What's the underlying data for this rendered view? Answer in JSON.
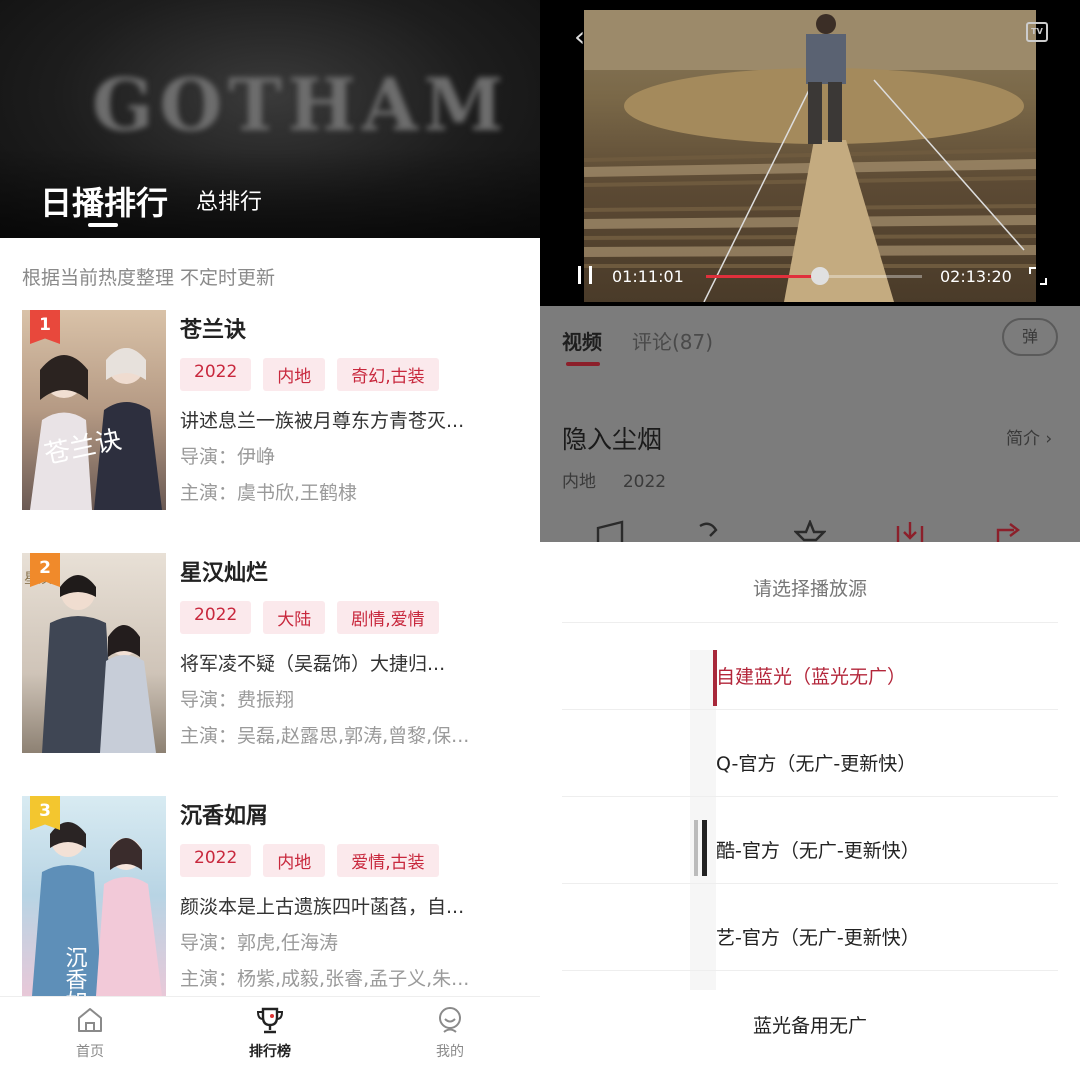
{
  "left": {
    "hero": {
      "background_text": "GOTHAM"
    },
    "tabs": {
      "daily": "日播排行",
      "total": "总排行"
    },
    "notice": "根据当前热度整理 不定时更新",
    "director_prefix": "导演：",
    "cast_prefix": "主演：",
    "items": [
      {
        "rank": "1",
        "rank_color": "#e8483c",
        "title": "苍兰诀",
        "year": "2022",
        "region": "内地",
        "genre": "奇幻,古装",
        "desc": "讲述息兰一族被月尊东方青苍灭...",
        "director": "伊峥",
        "cast": "虞书欣,王鹤棣"
      },
      {
        "rank": "2",
        "rank_color": "#f08a2b",
        "title": "星汉灿烂",
        "year": "2022",
        "region": "大陆",
        "genre": "剧情,爱情",
        "desc": "将军凌不疑（吴磊饰）大捷归...",
        "director": "费振翔",
        "cast": "吴磊,赵露思,郭涛,曾黎,保..."
      },
      {
        "rank": "3",
        "rank_color": "#f3c62f",
        "title": "沉香如屑",
        "year": "2022",
        "region": "内地",
        "genre": "爱情,古装",
        "desc": "颜淡本是上古遗族四叶菡萏，自...",
        "director": "郭虎,任海涛",
        "cast": "杨紫,成毅,张睿,孟子义,朱..."
      }
    ],
    "bottom_nav": {
      "home": "首页",
      "ranking": "排行榜",
      "mine": "我的"
    }
  },
  "right": {
    "player": {
      "current_time": "01:11:01",
      "total_time": "02:13:20",
      "progress": 0.53,
      "tv_label": "TV"
    },
    "tabs": {
      "video": "视频",
      "comments": "评论(87)"
    },
    "danmaku": "弹",
    "show": {
      "title": "隐入尘烟",
      "intro": "简介 ›",
      "region": "内地",
      "year": "2022"
    },
    "sheet": {
      "title": "请选择播放源",
      "sources": [
        "自建蓝光（蓝光无广）",
        "Q-官方（无广-更新快）",
        "酷-官方（无广-更新快）",
        "艺-官方（无广-更新快）",
        "蓝光备用无广"
      ]
    }
  }
}
